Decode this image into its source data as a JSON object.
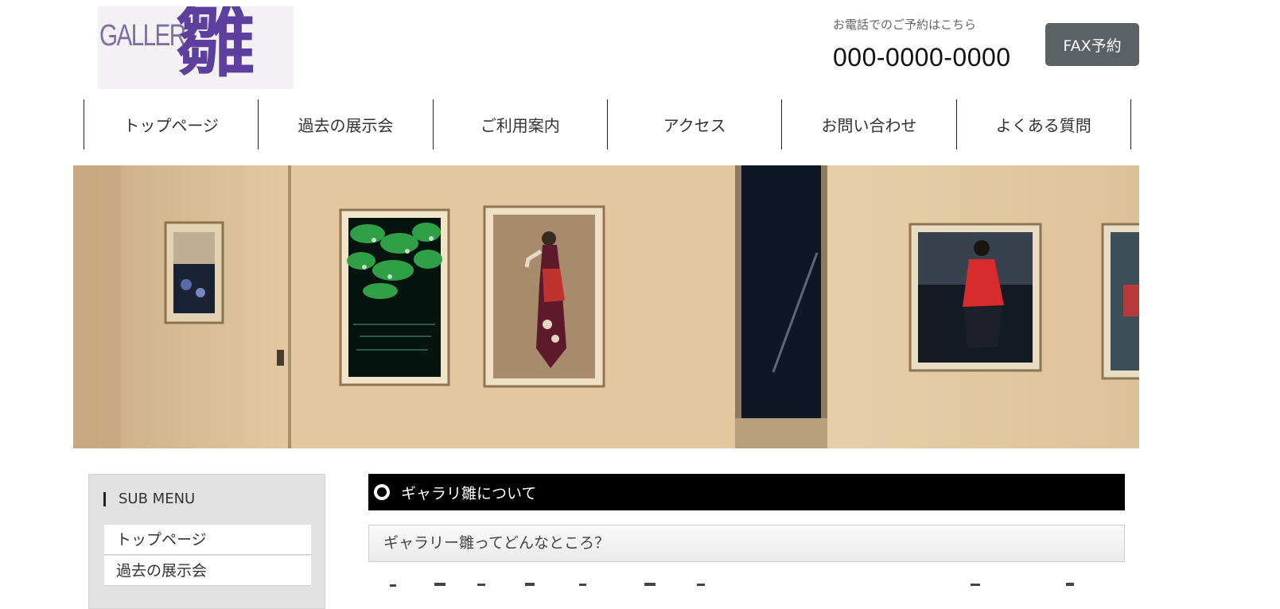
{
  "header": {
    "logo": {
      "latin": "GALLERY",
      "kanji": "雛"
    },
    "phone_caption": "お電話でのご予約はこちら",
    "phone_number": "000-0000-0000",
    "fax_button": "FAX予約"
  },
  "nav": [
    "トップページ",
    "過去の展示会",
    "ご利用案内",
    "アクセス",
    "お問い合わせ",
    "よくある質問"
  ],
  "hero": {
    "alt": ""
  },
  "sidebar": {
    "title": "SUB MENU",
    "items": [
      "トップページ",
      "過去の展示会"
    ]
  },
  "main": {
    "section_title": "ギャラリ雛について",
    "subheading": "ギャラリー雛ってどんなところ？"
  },
  "colors": {
    "fax_button_bg": "#5c6166",
    "section_heading_bg": "#000000",
    "logo_purple": "#5d3f9e"
  }
}
